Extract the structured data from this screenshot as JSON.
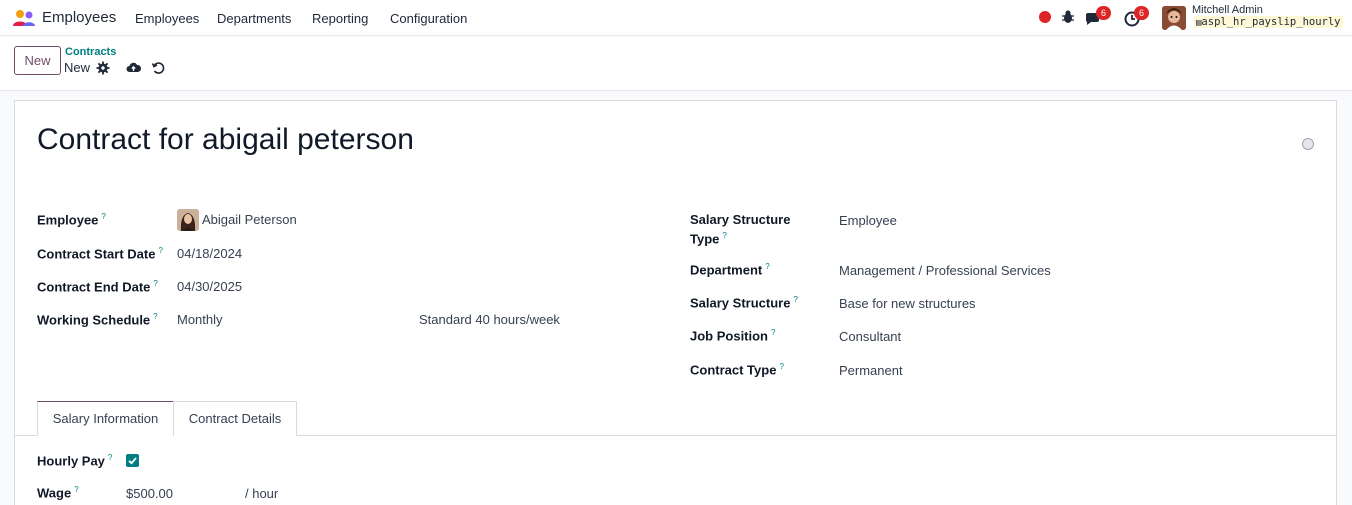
{
  "navbar": {
    "app_name": "Employees",
    "menu": [
      "Employees",
      "Departments",
      "Reporting",
      "Configuration"
    ],
    "messages_count": "6",
    "activities_count": "6",
    "user_name": "Mitchell Admin",
    "db_name": "aspl_hr_payslip_hourly"
  },
  "control": {
    "new_label": "New",
    "breadcrumb_parent": "Contracts",
    "breadcrumb_current": "New"
  },
  "form": {
    "title": "Contract for abigail peterson",
    "left": {
      "employee_label": "Employee",
      "employee_value": "Abigail Peterson",
      "start_label": "Contract Start Date",
      "start_value": "04/18/2024",
      "end_label": "Contract End Date",
      "end_value": "04/30/2025",
      "schedule_label": "Working Schedule",
      "schedule_value": "Monthly",
      "schedule_hours": "Standard 40 hours/week"
    },
    "right": {
      "sst_label_1": "Salary Structure",
      "sst_label_2": "Type",
      "sst_value": "Employee",
      "department_label": "Department",
      "department_value": "Management / Professional Services",
      "structure_label": "Salary Structure",
      "structure_value": "Base for new structures",
      "job_label": "Job Position",
      "job_value": "Consultant",
      "ctype_label": "Contract Type",
      "ctype_value": "Permanent"
    },
    "tabs": [
      "Salary Information",
      "Contract Details"
    ],
    "salary": {
      "hourly_label": "Hourly Pay",
      "hourly_checked": true,
      "wage_label": "Wage",
      "wage_value": "$500.00",
      "wage_unit": "/ hour"
    },
    "help_mark": "?"
  },
  "colors": {
    "brand": "#714b67",
    "accent": "#017e84",
    "badge": "#dc2626"
  }
}
